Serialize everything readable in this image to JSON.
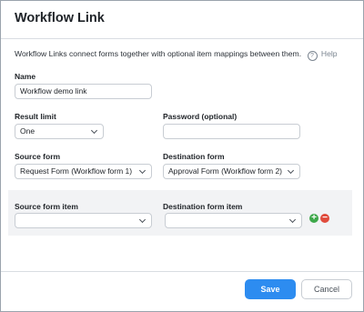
{
  "dialog": {
    "title": "Workflow Link",
    "intro": "Workflow Links connect forms together with optional item mappings between them.",
    "help_label": "Help"
  },
  "fields": {
    "name_label": "Name",
    "name_value": "Workflow demo link",
    "result_limit_label": "Result limit",
    "result_limit_value": "One",
    "password_label": "Password (optional)",
    "password_value": "",
    "source_form_label": "Source form",
    "source_form_value": "Request Form (Workflow form 1)",
    "destination_form_label": "Destination form",
    "destination_form_value": "Approval Form (Workflow form 2)"
  },
  "mapping": {
    "source_item_label": "Source form item",
    "source_item_value": "",
    "destination_item_label": "Destination form item",
    "destination_item_value": "",
    "add_symbol": "+",
    "remove_symbol": "−"
  },
  "footer": {
    "save_label": "Save",
    "cancel_label": "Cancel"
  },
  "colors": {
    "primary": "#2d8cf0",
    "add": "#3ea84b",
    "remove": "#e04b3c"
  },
  "icons": [
    "help-circle-icon",
    "chevron-down-icon",
    "plus-circle-icon",
    "minus-circle-icon"
  ]
}
